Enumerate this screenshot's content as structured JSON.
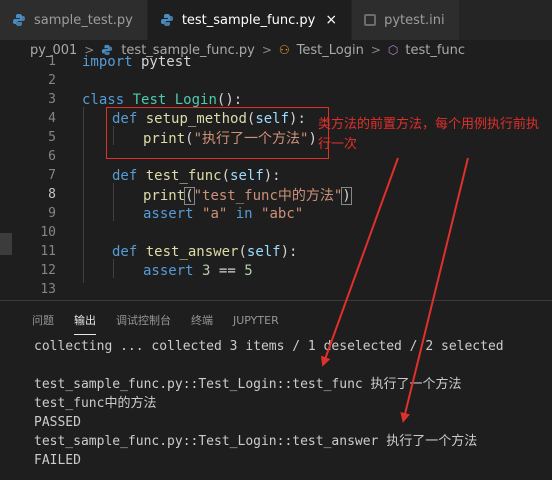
{
  "tabs": [
    {
      "label": "sample_test.py",
      "active": false
    },
    {
      "label": "test_sample_func.py",
      "active": true,
      "close": "×"
    },
    {
      "label": "pytest.ini",
      "active": false
    }
  ],
  "breadcrumb": {
    "folder": "py_001",
    "file": "test_sample_func.py",
    "class": "Test_Login",
    "function": "test_func"
  },
  "editor": {
    "line_numbers": [
      "1",
      "2",
      "3",
      "4",
      "5",
      "6",
      "7",
      "8",
      "9",
      "10",
      "11",
      "12",
      "13"
    ],
    "current_line": "8",
    "lines": {
      "l1": {
        "kw": "import",
        "rest": " pytest"
      },
      "l3": {
        "kw": "class",
        "name": "Test_Login",
        "tail": "():"
      },
      "l4": {
        "kw": "def",
        "name": "setup_method",
        "open": "(",
        "self": "self",
        "close": "):"
      },
      "l5": {
        "fn": "print",
        "open": "(",
        "str": "\"执行了一个方法\"",
        "close": ")"
      },
      "l7": {
        "kw": "def",
        "name": "test_func",
        "open": "(",
        "self": "self",
        "close": "):"
      },
      "l8": {
        "fn": "print",
        "open": "(",
        "str": "\"test_func中的方法\"",
        "close": ")"
      },
      "l9": {
        "kw": "assert",
        "str1": "\"a\"",
        "kw2": "in",
        "str2": "\"abc\""
      },
      "l11": {
        "kw": "def",
        "name": "test_answer",
        "open": "(",
        "self": "self",
        "close": "):"
      },
      "l12": {
        "kw": "assert",
        "num1": "3",
        "op": "==",
        "num2": "5"
      }
    }
  },
  "annotation": {
    "text": "类方法的前置方法，每个用例执行前执行一次",
    "color": "#e0302b"
  },
  "panel": {
    "tabs": [
      "问题",
      "输出",
      "调试控制台",
      "终端",
      "JUPYTER"
    ],
    "active_tab": "输出",
    "output": [
      "collecting ... collected 3 items / 1 deselected / 2 selected",
      "",
      "test_sample_func.py::Test_Login::test_func 执行了一个方法",
      "test_func中的方法",
      "PASSED",
      "test_sample_func.py::Test_Login::test_answer 执行了一个方法",
      "FAILED"
    ]
  }
}
